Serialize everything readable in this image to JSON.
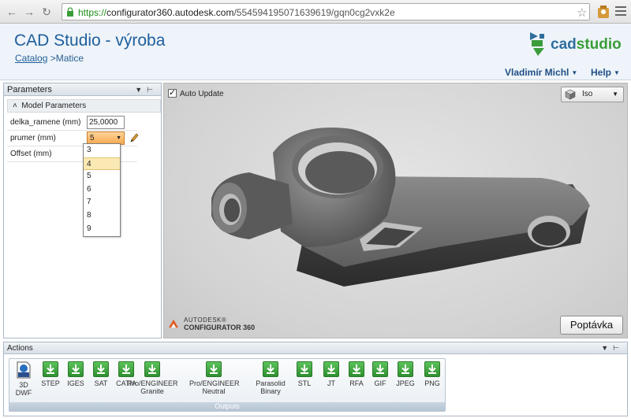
{
  "browser": {
    "url_scheme": "https://",
    "url_host": "configurator360.autodesk.com",
    "url_path": "/554594195071639619/gqn0cg2vxk2e",
    "back_icon": "back-arrow-icon",
    "forward_icon": "forward-arrow-icon",
    "reload_icon": "reload-icon"
  },
  "header": {
    "title": "CAD Studio - výroba",
    "breadcrumb_link": "Catalog",
    "breadcrumb_current": ">Matice",
    "logo_text_a": "cad",
    "logo_text_b": "studio",
    "user_name": "Vladimír Michl",
    "help_label": "Help"
  },
  "params_panel": {
    "title": "Parameters",
    "section": "Model Parameters",
    "rows": [
      {
        "label": "delka_ramene (mm)",
        "value": "25,0000"
      },
      {
        "label": "prumer (mm)",
        "value": "5"
      },
      {
        "label": "Offset (mm)",
        "value": ""
      }
    ],
    "dropdown_options": [
      "3",
      "4",
      "5",
      "6",
      "7",
      "8",
      "9"
    ],
    "dropdown_highlight": "4"
  },
  "viewport": {
    "auto_update_label": "Auto Update",
    "auto_update_checked": true,
    "view_mode": "Iso",
    "brand_line1": "AUTODESK®",
    "brand_line2": "CONFIGURATOR 360",
    "quote_button": "Poptávka"
  },
  "actions": {
    "title": "Actions",
    "group_label": "Outputs",
    "buttons": [
      {
        "label1": "3D",
        "label2": "DWF",
        "icon": "dwf-file-icon"
      },
      {
        "label1": "STEP",
        "label2": "",
        "icon": "download-icon"
      },
      {
        "label1": "IGES",
        "label2": "",
        "icon": "download-icon"
      },
      {
        "label1": "SAT",
        "label2": "",
        "icon": "download-icon"
      },
      {
        "label1": "CATIA",
        "label2": "",
        "icon": "download-icon"
      },
      {
        "label1": "Pro/ENGINEER",
        "label2": "Granite",
        "icon": "download-icon"
      },
      {
        "label1": "Pro/ENGINEER",
        "label2": "Neutral",
        "icon": "download-icon"
      },
      {
        "label1": "Parasolid",
        "label2": "Binary",
        "icon": "download-icon"
      },
      {
        "label1": "STL",
        "label2": "",
        "icon": "download-icon"
      },
      {
        "label1": "JT",
        "label2": "",
        "icon": "download-icon"
      },
      {
        "label1": "RFA",
        "label2": "",
        "icon": "download-icon"
      },
      {
        "label1": "GIF",
        "label2": "",
        "icon": "download-icon"
      },
      {
        "label1": "JPEG",
        "label2": "",
        "icon": "download-icon"
      },
      {
        "label1": "PNG",
        "label2": "",
        "icon": "download-icon"
      }
    ]
  },
  "colors": {
    "header_bg": "#eef4f9",
    "title_blue": "#1f5e9c",
    "brand_green": "#3a9d3a",
    "select_orange": "#f5a84f",
    "download_green": "#2e8f2e"
  }
}
